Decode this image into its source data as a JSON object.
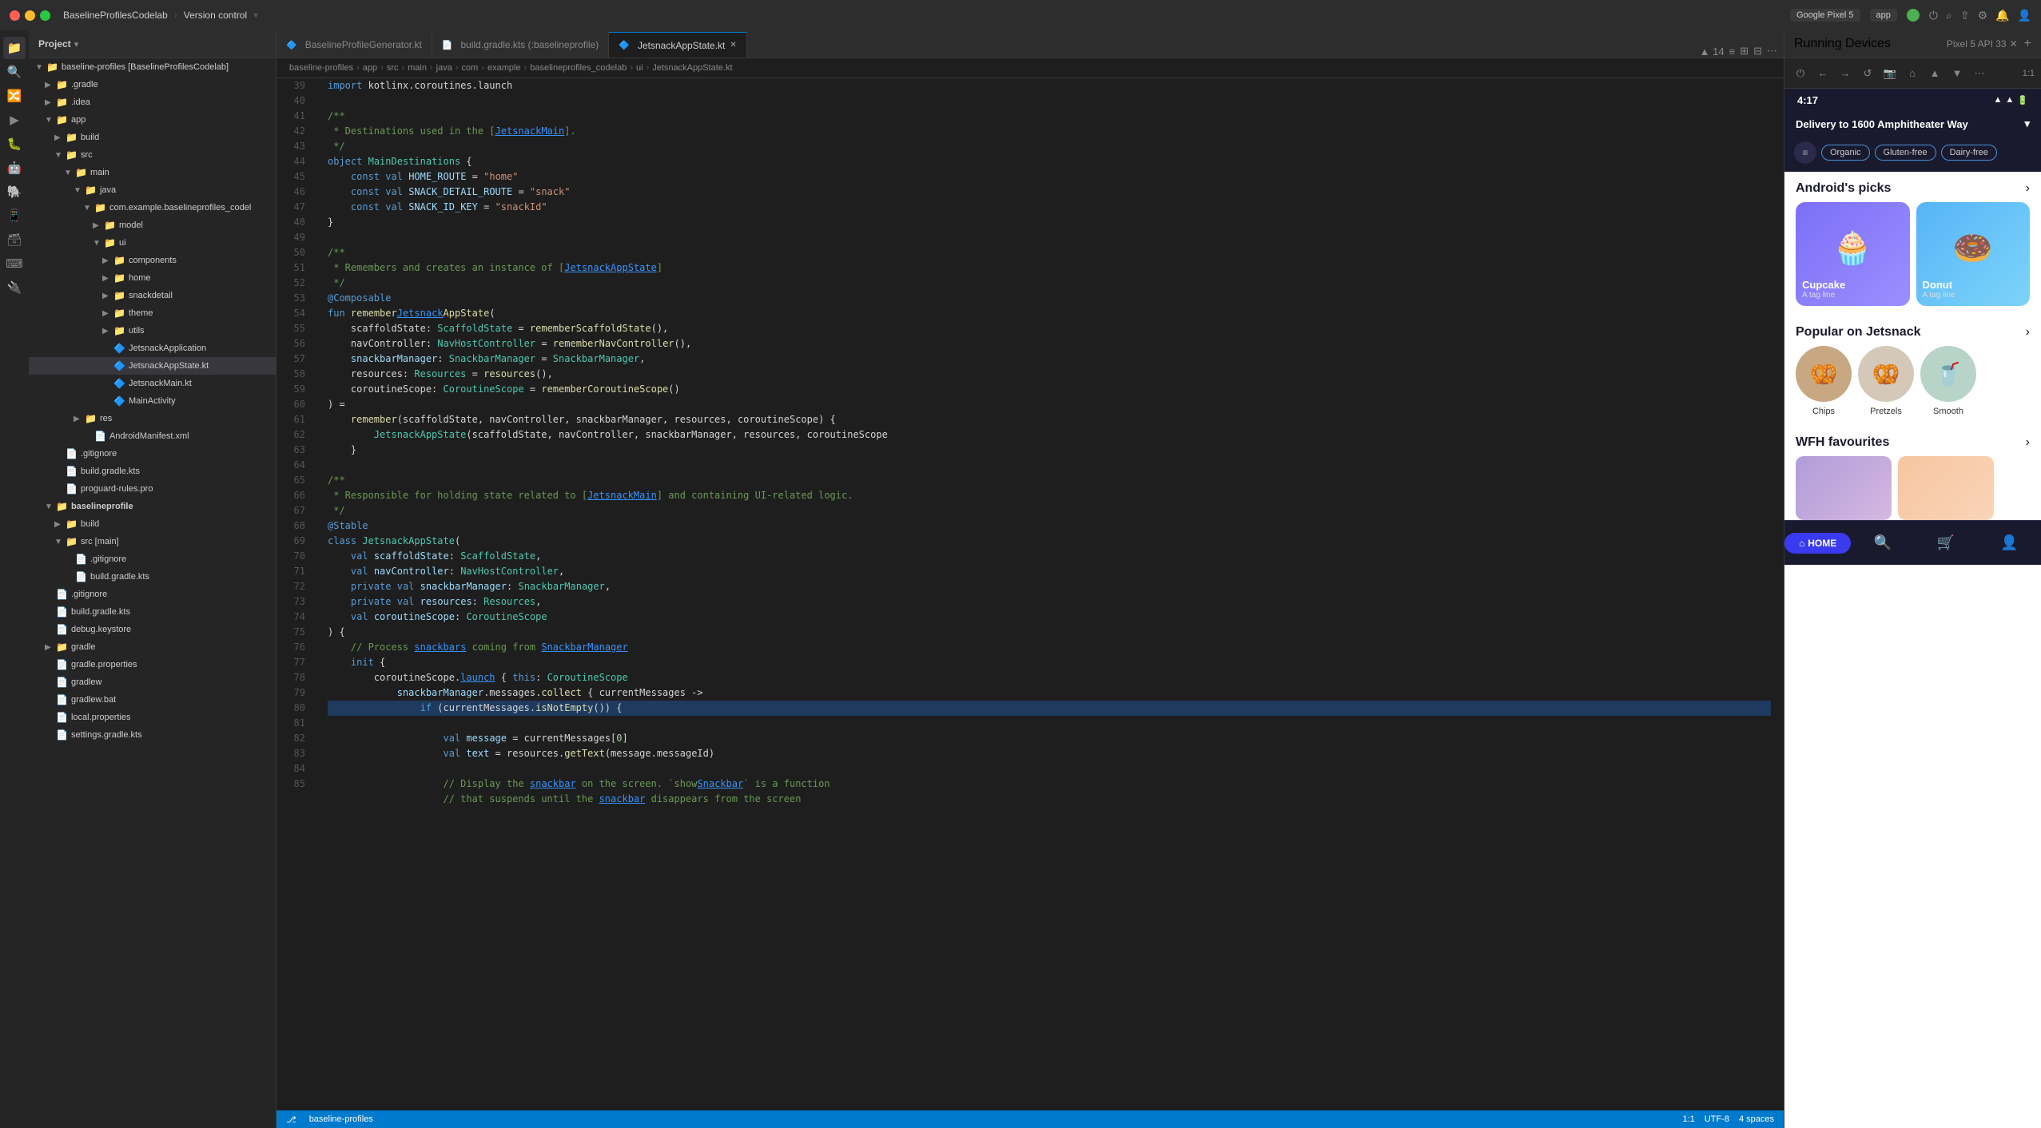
{
  "titlebar": {
    "app_name": "BaselineProfilesCodelab",
    "version_control": "Version control",
    "device_name": "Google Pixel 5",
    "app_label": "app",
    "tabs": [
      {
        "label": "BaselineProfileGenerator.kt",
        "active": false
      },
      {
        "label": "build.gradle.kts (:baselineprofile)",
        "active": false
      },
      {
        "label": "JetsnackAppState.kt",
        "active": true
      }
    ]
  },
  "project": {
    "label": "Project"
  },
  "file_tree": {
    "root": "baseline-profiles [BaselineProfilesCodelab]",
    "items": [
      {
        "label": ".gradle",
        "type": "folder",
        "depth": 1,
        "expanded": false
      },
      {
        "label": ".idea",
        "type": "folder",
        "depth": 1,
        "expanded": false
      },
      {
        "label": "app",
        "type": "folder",
        "depth": 1,
        "expanded": true
      },
      {
        "label": "build",
        "type": "folder",
        "depth": 2,
        "expanded": false
      },
      {
        "label": "src",
        "type": "folder",
        "depth": 2,
        "expanded": true
      },
      {
        "label": "main",
        "type": "folder",
        "depth": 3,
        "expanded": true
      },
      {
        "label": "java",
        "type": "folder",
        "depth": 4,
        "expanded": true
      },
      {
        "label": "com.example.baselineprofiles_codel",
        "type": "folder",
        "depth": 5,
        "expanded": true
      },
      {
        "label": "model",
        "type": "folder",
        "depth": 6,
        "expanded": false
      },
      {
        "label": "ui",
        "type": "folder",
        "depth": 6,
        "expanded": true
      },
      {
        "label": "components",
        "type": "folder",
        "depth": 7,
        "expanded": false
      },
      {
        "label": "home",
        "type": "folder",
        "depth": 7,
        "expanded": false
      },
      {
        "label": "snackdetail",
        "type": "folder",
        "depth": 7,
        "expanded": false
      },
      {
        "label": "theme",
        "type": "folder",
        "depth": 7,
        "expanded": false
      },
      {
        "label": "utils",
        "type": "folder",
        "depth": 7,
        "expanded": false
      },
      {
        "label": "JetsnackApplication",
        "type": "kt",
        "depth": 7
      },
      {
        "label": "JetsnackAppState.kt",
        "type": "kt",
        "depth": 7,
        "selected": true
      },
      {
        "label": "JetsnackMain.kt",
        "type": "kt",
        "depth": 7
      },
      {
        "label": "MainActivity",
        "type": "kt",
        "depth": 7
      },
      {
        "label": "res",
        "type": "folder",
        "depth": 4,
        "expanded": false
      },
      {
        "label": "AndroidManifest.xml",
        "type": "xml",
        "depth": 5
      },
      {
        "label": ".gitignore",
        "type": "txt",
        "depth": 2
      },
      {
        "label": "build.gradle.kts",
        "type": "kts",
        "depth": 2
      },
      {
        "label": "proguard-rules.pro",
        "type": "txt",
        "depth": 2
      },
      {
        "label": "baselineprofile",
        "type": "folder",
        "depth": 1,
        "expanded": true,
        "bold": true
      },
      {
        "label": "build",
        "type": "folder",
        "depth": 2,
        "expanded": false
      },
      {
        "label": "src [main]",
        "type": "folder",
        "depth": 2,
        "expanded": true
      },
      {
        "label": ".gitignore",
        "type": "txt",
        "depth": 3
      },
      {
        "label": "build.gradle.kts",
        "type": "kts",
        "depth": 3
      },
      {
        "label": ".gitignore",
        "type": "txt",
        "depth": 1
      },
      {
        "label": "build.gradle.kts",
        "type": "kts",
        "depth": 1
      },
      {
        "label": "debug.keystore",
        "type": "txt",
        "depth": 1
      },
      {
        "label": "gradle",
        "type": "folder",
        "depth": 1,
        "expanded": false
      },
      {
        "label": "gradle.properties",
        "type": "props",
        "depth": 1
      },
      {
        "label": "gradlew",
        "type": "txt",
        "depth": 1
      },
      {
        "label": "gradlew.bat",
        "type": "txt",
        "depth": 1
      },
      {
        "label": "local.properties",
        "type": "props",
        "depth": 1
      },
      {
        "label": "settings.gradle.kts",
        "type": "kts",
        "depth": 1
      }
    ]
  },
  "editor": {
    "active_file": "JetsnackAppState.kt",
    "line_count": "▲ 14",
    "breadcrumb": [
      "baseline-profiles",
      "app",
      "src",
      "main",
      "java",
      "com",
      "example",
      "baselineprofiles_codelab",
      "ui",
      "JetsnackAppState.kt"
    ]
  },
  "running_devices": {
    "title": "Running Devices",
    "pixel_label": "Pixel 5 API 33",
    "zoom": "1:1",
    "encoding": "UTF-8",
    "spaces": "4 spaces"
  },
  "phone": {
    "time": "4:17",
    "delivery_text": "Delivery to 1600 Amphitheater Way",
    "filters": [
      "Organic",
      "Gluten-free",
      "Dairy-free"
    ],
    "androids_picks": "Android's picks",
    "items": [
      {
        "name": "Cupcake",
        "tagline": "A tag line"
      },
      {
        "name": "Donut",
        "tagline": "A tag line"
      }
    ],
    "popular_title": "Popular on Jetsnack",
    "popular_items": [
      "Chips",
      "Pretzels",
      "Smooth"
    ],
    "wfh_title": "WFH favourites",
    "nav": [
      "HOME",
      "search",
      "cart",
      "profile"
    ]
  },
  "status_bar": {
    "branch": "baseline-profiles",
    "path": "app > src > main > java > com > example > baselineprofiles_codelab > ui > JetsnackAppState.kt",
    "line_col": "1:1",
    "encoding": "UTF-8",
    "indent": "4 spaces"
  }
}
